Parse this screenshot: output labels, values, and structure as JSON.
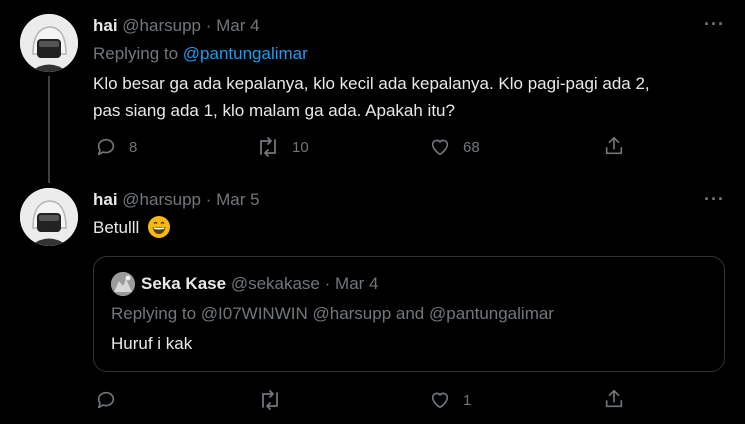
{
  "tweet1": {
    "name": "hai",
    "handle": "@harsupp",
    "sep": "·",
    "date": "Mar 4",
    "replying_label": "Replying to",
    "replying_to": "@pantungalimar",
    "text_line1": "Klo besar ga ada kepalanya, klo kecil ada kepalanya. Klo pagi-pagi ada 2,",
    "text_line2": "pas siang ada 1, klo malam ga ada. Apakah itu?",
    "reply_count": "8",
    "retweet_count": "10",
    "like_count": "68"
  },
  "tweet2": {
    "name": "hai",
    "handle": "@harsupp",
    "sep": "·",
    "date": "Mar 5",
    "text": "Betulll",
    "like_count": "1"
  },
  "quote": {
    "name": "Seka Kase",
    "handle": "@sekakase",
    "sep": "·",
    "date": "Mar 4",
    "replying": "Replying to @I07WINWIN @harsupp and @pantungalimar",
    "text": "Huruf i kak"
  },
  "icons": {
    "more": "more-horizontal-icon",
    "reply": "reply-icon",
    "retweet": "retweet-icon",
    "like": "heart-icon",
    "share": "share-icon",
    "emoji": "grinning-face-emoji"
  },
  "colors": {
    "background": "#000000",
    "text": "#e7e9ea",
    "muted": "#71767b",
    "link": "#1d9bf0",
    "border": "#2f3336"
  }
}
